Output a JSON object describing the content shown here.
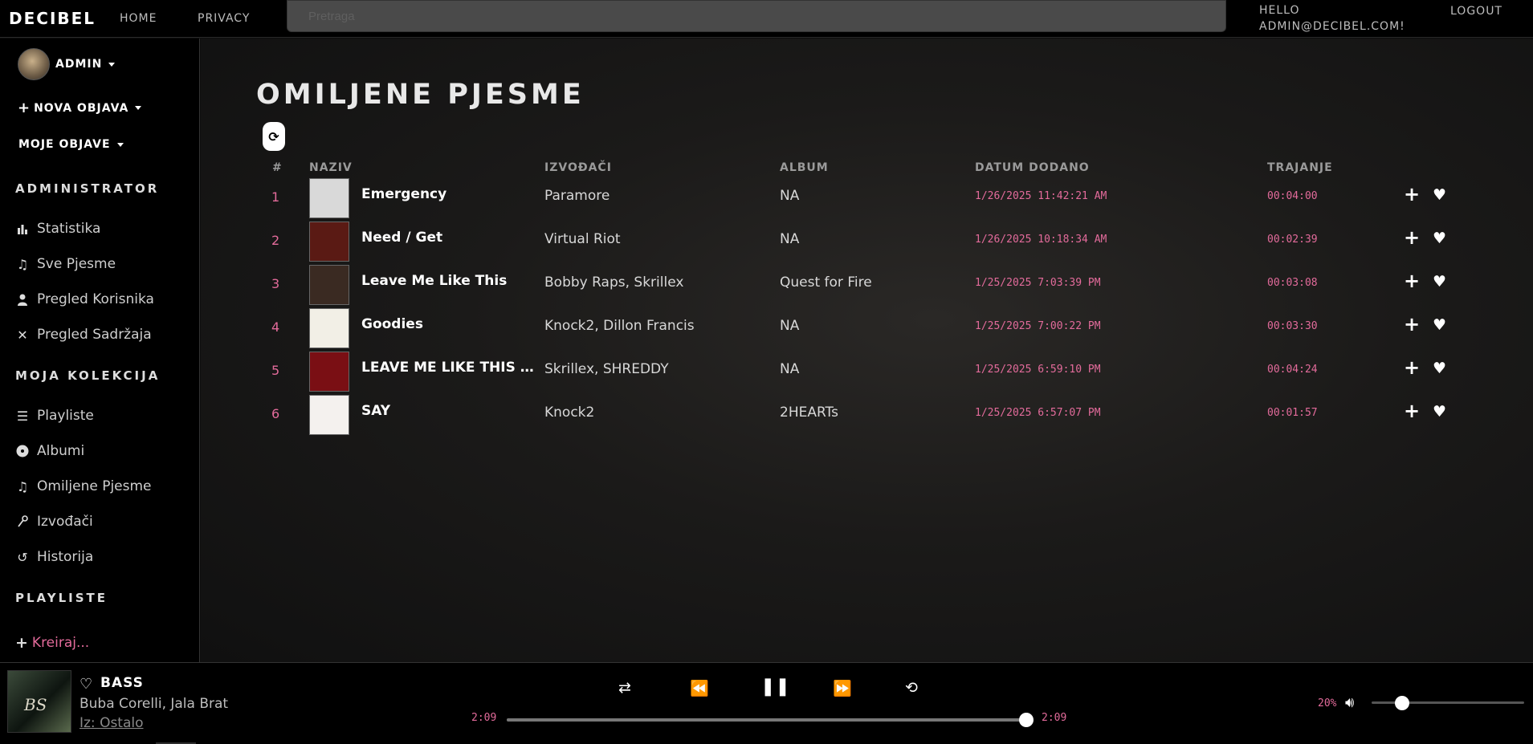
{
  "nav": {
    "brand": "DECIBEL",
    "home": "HOME",
    "privacy": "PRIVACY",
    "search_placeholder": "Pretraga",
    "hello_line1": "HELLO",
    "hello_line2": "ADMIN@DECIBEL.COM!",
    "logout": "LOGOUT"
  },
  "sidebar": {
    "user": "ADMIN",
    "nova_objava": "NOVA OBJAVA",
    "moje_objave": "MOJE OBJAVE",
    "admin_section": "ADMINISTRATOR",
    "admin_items": [
      {
        "label": "Statistika",
        "icon": "bar-chart-icon"
      },
      {
        "label": "Sve Pjesme",
        "icon": "music-note-icon"
      },
      {
        "label": "Pregled Korisnika",
        "icon": "user-icon"
      },
      {
        "label": "Pregled Sadržaja",
        "icon": "tools-icon"
      }
    ],
    "collection_section": "MOJA KOLEKCIJA",
    "collection_items": [
      {
        "label": "Playliste",
        "icon": "list-icon"
      },
      {
        "label": "Albumi",
        "icon": "disc-icon"
      },
      {
        "label": "Omiljene Pjesme",
        "icon": "music-note-icon"
      },
      {
        "label": "Izvođači",
        "icon": "microphone-icon"
      },
      {
        "label": "Historija",
        "icon": "history-icon"
      }
    ],
    "playlists_section": "PLAYLISTE",
    "create_label": "Kreiraj..."
  },
  "main": {
    "title": "OMILJENE PJESME",
    "headers": {
      "num": "#",
      "naziv": "NAZIV",
      "izvodjaci": "IZVOĐAČI",
      "album": "ALBUM",
      "datum": "DATUM DODANO",
      "trajanje": "TRAJANJE"
    },
    "songs": [
      {
        "num": "1",
        "title": "Emergency",
        "artists": "Paramore",
        "album": "NA",
        "date": "1/26/2025 11:42:21 AM",
        "duration": "00:04:00"
      },
      {
        "num": "2",
        "title": "Need / Get",
        "artists": "Virtual Riot",
        "album": "NA",
        "date": "1/26/2025 10:18:34 AM",
        "duration": "00:02:39"
      },
      {
        "num": "3",
        "title": "Leave Me Like This",
        "artists": "Bobby Raps, Skrillex",
        "album": "Quest for Fire",
        "date": "1/25/2025 7:03:39 PM",
        "duration": "00:03:08"
      },
      {
        "num": "4",
        "title": "Goodies",
        "artists": "Knock2, Dillon Francis",
        "album": "NA",
        "date": "1/25/2025 7:00:22 PM",
        "duration": "00:03:30"
      },
      {
        "num": "5",
        "title": "LEAVE ME LIKE THIS (SHREDDY REMIX)",
        "artists": "Skrillex, SHREDDY",
        "album": "NA",
        "date": "1/25/2025 6:59:10 PM",
        "duration": "00:04:24"
      },
      {
        "num": "6",
        "title": "SAY",
        "artists": "Knock2",
        "album": "2HEARTs",
        "date": "1/25/2025 6:57:07 PM",
        "duration": "00:01:57"
      }
    ],
    "thumb_colors": [
      "#d9d9d9",
      "#5a1a14",
      "#3a2a22",
      "#f2efe6",
      "#7a0f14",
      "#f4f1ee"
    ],
    "accent_color": "#e36b9b"
  },
  "player": {
    "title": "BASS",
    "artists": "Buba Corelli, Jala Brat",
    "from": "Iz: Ostalo",
    "cover_text": "BS",
    "time_current": "2:09",
    "time_total": "2:09",
    "progress_fraction": 1.0,
    "volume": "20%",
    "volume_fraction": 0.2
  }
}
